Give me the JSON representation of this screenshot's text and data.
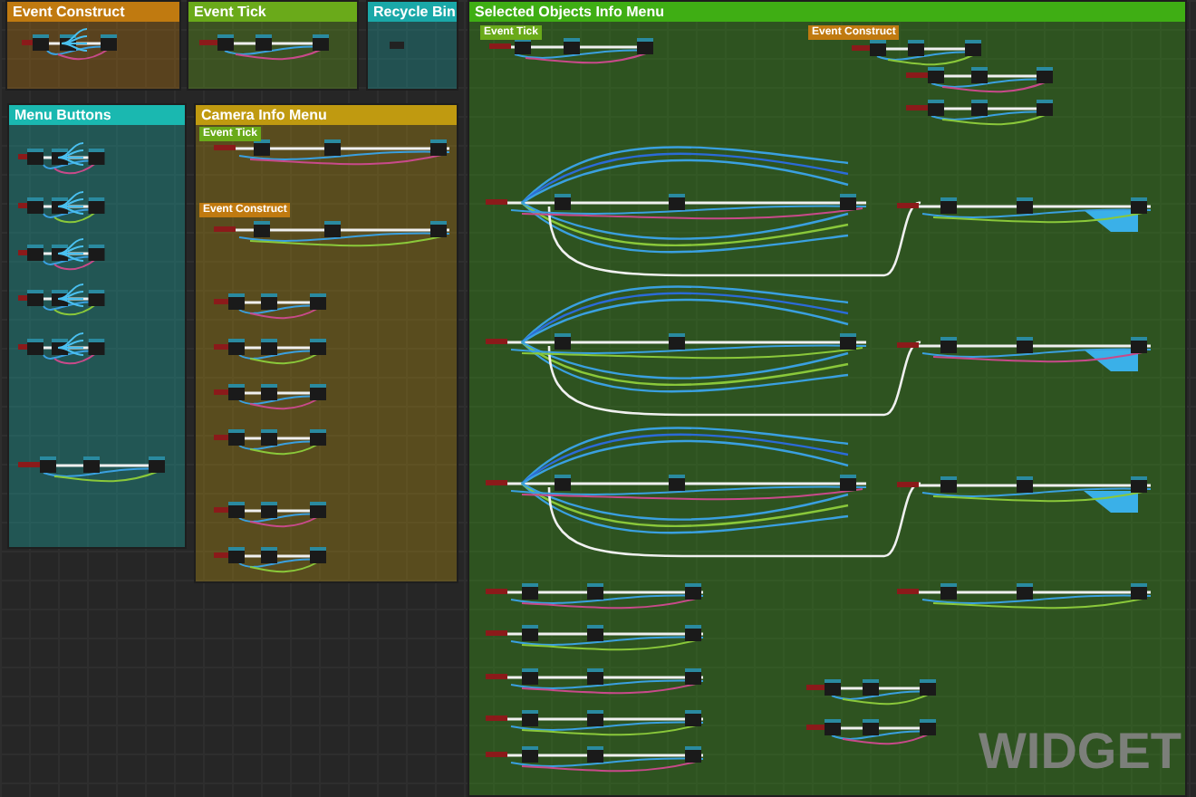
{
  "comments": [
    {
      "title": "Event Construct",
      "color": "#c07a10"
    },
    {
      "title": "Event Tick",
      "color": "#6aaa1a"
    },
    {
      "title": "Recycle Bin",
      "color": "#1aa8a8"
    },
    {
      "title": "Selected Objects Info Menu",
      "color": "#3fae14",
      "nodes": [
        {
          "title": "Event Tick",
          "color": "#6aaa1a"
        },
        {
          "title": "Event Construct",
          "color": "#c07a10"
        }
      ]
    },
    {
      "title": "Menu Buttons",
      "color": "#1ab8b0"
    },
    {
      "title": "Camera Info Menu",
      "color": "#c09a10",
      "nodes": [
        {
          "title": "Event Tick",
          "color": "#6aaa1a"
        },
        {
          "title": "Event Construct",
          "color": "#c07a10"
        }
      ]
    }
  ],
  "graph_type": "WIDGET"
}
